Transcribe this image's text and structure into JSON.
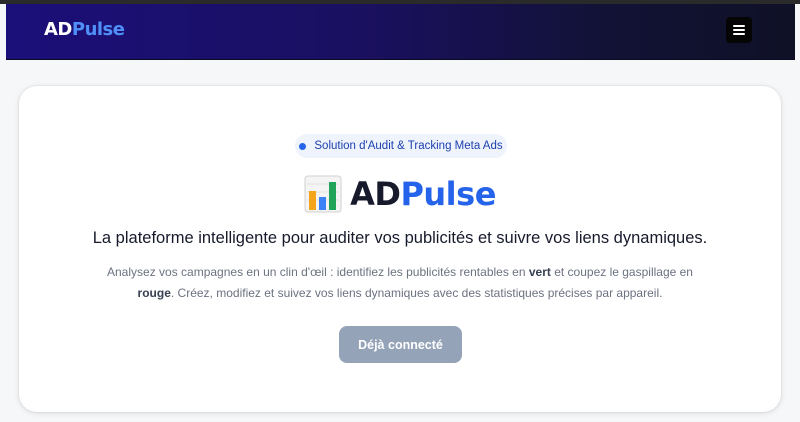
{
  "navbar": {
    "logo_ad": "AD",
    "logo_pulse": "Pulse",
    "menu_icon": "hamburger-menu-icon"
  },
  "hero": {
    "badge_text": "Solution d'Audit & Tracking Meta Ads",
    "brand_icon": "bar-chart-icon",
    "brand_ad": "AD",
    "brand_pulse": "Pulse",
    "tagline": "La plateforme intelligente pour auditer vos publicités et suivre vos liens dynamiques.",
    "desc_part1": "Analysez vos campagnes en un clin d'œil : identifiez les publicités rentables en ",
    "desc_bold1": "vert",
    "desc_part2": " et coupez le gaspillage en ",
    "desc_bold2": "rouge",
    "desc_part3": ". Créez, modifiez et suivez vos liens dynamiques avec des statistiques précises par appareil.",
    "cta_label": "Déjà connecté"
  },
  "colors": {
    "accent": "#2563eb",
    "navbar_start": "#1b0f7a",
    "navbar_end": "#0f1126",
    "cta_disabled": "#94a3b8"
  }
}
